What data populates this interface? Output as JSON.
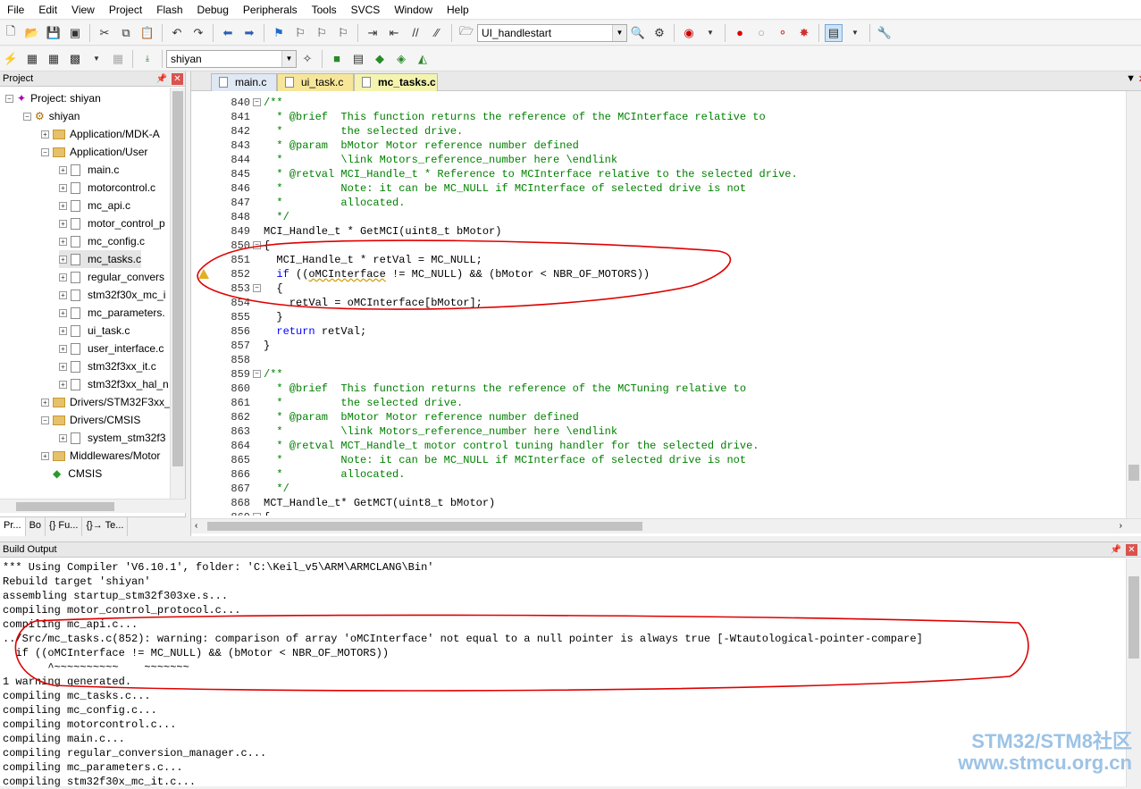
{
  "menu": [
    "File",
    "Edit",
    "View",
    "Project",
    "Flash",
    "Debug",
    "Peripherals",
    "Tools",
    "SVCS",
    "Window",
    "Help"
  ],
  "toolbar": {
    "function_combo": "UI_handlestart",
    "target_combo": "shiyan"
  },
  "project_panel": {
    "title": "Project",
    "root": "Project: shiyan",
    "target": "shiyan",
    "items": [
      {
        "label": "Application/MDK-A",
        "type": "folder",
        "level": 2,
        "exp": "+"
      },
      {
        "label": "Application/User",
        "type": "folder",
        "level": 2,
        "exp": "-"
      },
      {
        "label": "main.c",
        "type": "file",
        "level": 3
      },
      {
        "label": "motorcontrol.c",
        "type": "file",
        "level": 3
      },
      {
        "label": "mc_api.c",
        "type": "file",
        "level": 3
      },
      {
        "label": "motor_control_p",
        "type": "file",
        "level": 3
      },
      {
        "label": "mc_config.c",
        "type": "file",
        "level": 3
      },
      {
        "label": "mc_tasks.c",
        "type": "file",
        "level": 3,
        "selected": true
      },
      {
        "label": "regular_convers",
        "type": "file",
        "level": 3
      },
      {
        "label": "stm32f30x_mc_i",
        "type": "file",
        "level": 3
      },
      {
        "label": "mc_parameters.",
        "type": "file",
        "level": 3
      },
      {
        "label": "ui_task.c",
        "type": "file",
        "level": 3
      },
      {
        "label": "user_interface.c",
        "type": "file",
        "level": 3
      },
      {
        "label": "stm32f3xx_it.c",
        "type": "file",
        "level": 3
      },
      {
        "label": "stm32f3xx_hal_n",
        "type": "file",
        "level": 3
      },
      {
        "label": "Drivers/STM32F3xx_",
        "type": "folder",
        "level": 2,
        "exp": "+"
      },
      {
        "label": "Drivers/CMSIS",
        "type": "folder",
        "level": 2,
        "exp": "-"
      },
      {
        "label": "system_stm32f3",
        "type": "file",
        "level": 3
      },
      {
        "label": "Middlewares/Motor",
        "type": "folder",
        "level": 2,
        "exp": "+"
      },
      {
        "label": "CMSIS",
        "type": "diamond",
        "level": 2
      }
    ],
    "bottom_tabs": [
      "Pr...",
      "Bo",
      "{} Fu...",
      "{}→ Te..."
    ]
  },
  "editor": {
    "tabs": [
      "main.c",
      "ui_task.c",
      "mc_tasks.c"
    ],
    "active_tab": "mc_tasks.c",
    "lines": [
      {
        "n": "840",
        "f": "-",
        "t": "/**",
        "c": "cm"
      },
      {
        "n": "841",
        "t": "  * @brief  This function returns the reference of the MCInterface relative to",
        "c": "cm"
      },
      {
        "n": "842",
        "t": "  *         the selected drive.",
        "c": "cm"
      },
      {
        "n": "843",
        "t": "  * @param  bMotor Motor reference number defined",
        "c": "cm"
      },
      {
        "n": "844",
        "t": "  *         \\link Motors_reference_number here \\endlink",
        "c": "cm"
      },
      {
        "n": "845",
        "t": "  * @retval MCI_Handle_t * Reference to MCInterface relative to the selected drive.",
        "c": "cm"
      },
      {
        "n": "846",
        "t": "  *         Note: it can be MC_NULL if MCInterface of selected drive is not",
        "c": "cm"
      },
      {
        "n": "847",
        "t": "  *         allocated.",
        "c": "cm"
      },
      {
        "n": "848",
        "t": "  */",
        "c": "cm"
      },
      {
        "n": "849",
        "t": "MCI_Handle_t * GetMCI(uint8_t bMotor)",
        "c": ""
      },
      {
        "n": "850",
        "f": "-",
        "t": "{",
        "c": ""
      },
      {
        "n": "851",
        "t": "  MCI_Handle_t * retVal = MC_NULL;",
        "c": ""
      },
      {
        "n": "852",
        "t": "  if ((oMCInterface != MC_NULL) && (bMotor < NBR_OF_MOTORS))",
        "c": "if",
        "warn": true
      },
      {
        "n": "853",
        "f": "-",
        "t": "  {",
        "c": ""
      },
      {
        "n": "854",
        "t": "    retVal = oMCInterface[bMotor];",
        "c": ""
      },
      {
        "n": "855",
        "t": "  }",
        "c": ""
      },
      {
        "n": "856",
        "t": "  return retVal;",
        "c": "ret"
      },
      {
        "n": "857",
        "t": "}",
        "c": ""
      },
      {
        "n": "858",
        "t": "",
        "c": ""
      },
      {
        "n": "859",
        "f": "-",
        "t": "/**",
        "c": "cm"
      },
      {
        "n": "860",
        "t": "  * @brief  This function returns the reference of the MCTuning relative to",
        "c": "cm"
      },
      {
        "n": "861",
        "t": "  *         the selected drive.",
        "c": "cm"
      },
      {
        "n": "862",
        "t": "  * @param  bMotor Motor reference number defined",
        "c": "cm"
      },
      {
        "n": "863",
        "t": "  *         \\link Motors_reference_number here \\endlink",
        "c": "cm"
      },
      {
        "n": "864",
        "t": "  * @retval MCT_Handle_t motor control tuning handler for the selected drive.",
        "c": "cm"
      },
      {
        "n": "865",
        "t": "  *         Note: it can be MC_NULL if MCInterface of selected drive is not",
        "c": "cm"
      },
      {
        "n": "866",
        "t": "  *         allocated.",
        "c": "cm"
      },
      {
        "n": "867",
        "t": "  */",
        "c": "cm"
      },
      {
        "n": "868",
        "t": "MCT_Handle_t* GetMCT(uint8_t bMotor)",
        "c": ""
      },
      {
        "n": "869",
        "f": "-",
        "t": "{",
        "c": ""
      }
    ]
  },
  "build_output": {
    "title": "Build Output",
    "lines": [
      "*** Using Compiler 'V6.10.1', folder: 'C:\\Keil_v5\\ARM\\ARMCLANG\\Bin'",
      "Rebuild target 'shiyan'",
      "assembling startup_stm32f303xe.s...",
      "compiling motor_control_protocol.c...",
      "compiling mc_api.c...",
      "../Src/mc_tasks.c(852): warning: comparison of array 'oMCInterface' not equal to a null pointer is always true [-Wtautological-pointer-compare]",
      "  if ((oMCInterface != MC_NULL) && (bMotor < NBR_OF_MOTORS))",
      "       ^~~~~~~~~~~    ~~~~~~~",
      "1 warning generated.",
      "compiling mc_tasks.c...",
      "compiling mc_config.c...",
      "compiling motorcontrol.c...",
      "compiling main.c...",
      "compiling regular_conversion_manager.c...",
      "compiling mc_parameters.c...",
      "compiling stm32f30x_mc_it.c..."
    ]
  },
  "watermark": {
    "line1": "STM32/STM8社区",
    "line2": "www.stmcu.org.cn"
  },
  "annotation_color": "#e00000"
}
